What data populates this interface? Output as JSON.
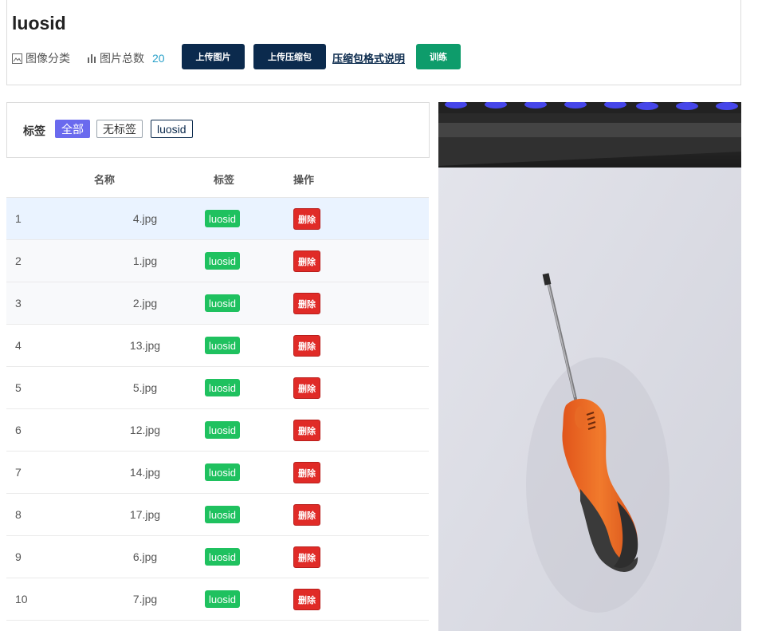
{
  "header": {
    "title": "luosid",
    "category_label": "图像分类",
    "total_label": "图片总数",
    "total_count": "20",
    "upload_image_label": "上传图片",
    "upload_zip_label": "上传压缩包",
    "zip_format_help_label": "压缩包格式说明",
    "train_label": "训练"
  },
  "filter": {
    "label": "标签",
    "tags": [
      "全部",
      "无标签",
      "luosid"
    ],
    "active_tag": "全部"
  },
  "table": {
    "headers": {
      "name": "名称",
      "tag": "标签",
      "action": "操作"
    },
    "delete_label": "删除",
    "rows": [
      {
        "index": "1",
        "name": "4.jpg",
        "tag": "luosid"
      },
      {
        "index": "2",
        "name": "1.jpg",
        "tag": "luosid"
      },
      {
        "index": "3",
        "name": "2.jpg",
        "tag": "luosid"
      },
      {
        "index": "4",
        "name": "13.jpg",
        "tag": "luosid"
      },
      {
        "index": "5",
        "name": "5.jpg",
        "tag": "luosid"
      },
      {
        "index": "6",
        "name": "12.jpg",
        "tag": "luosid"
      },
      {
        "index": "7",
        "name": "14.jpg",
        "tag": "luosid"
      },
      {
        "index": "8",
        "name": "17.jpg",
        "tag": "luosid"
      },
      {
        "index": "9",
        "name": "6.jpg",
        "tag": "luosid"
      },
      {
        "index": "10",
        "name": "7.jpg",
        "tag": "luosid"
      }
    ]
  },
  "colors": {
    "navy": "#0b2a4d",
    "train_green": "#0e9c6b",
    "tag_badge_green": "#1fc15f",
    "delete_red": "#e02b27",
    "active_filter": "#6a6aee",
    "count_blue": "#2aa1c9"
  },
  "icons": {
    "category": "image-icon",
    "total": "bar-chart-icon"
  }
}
